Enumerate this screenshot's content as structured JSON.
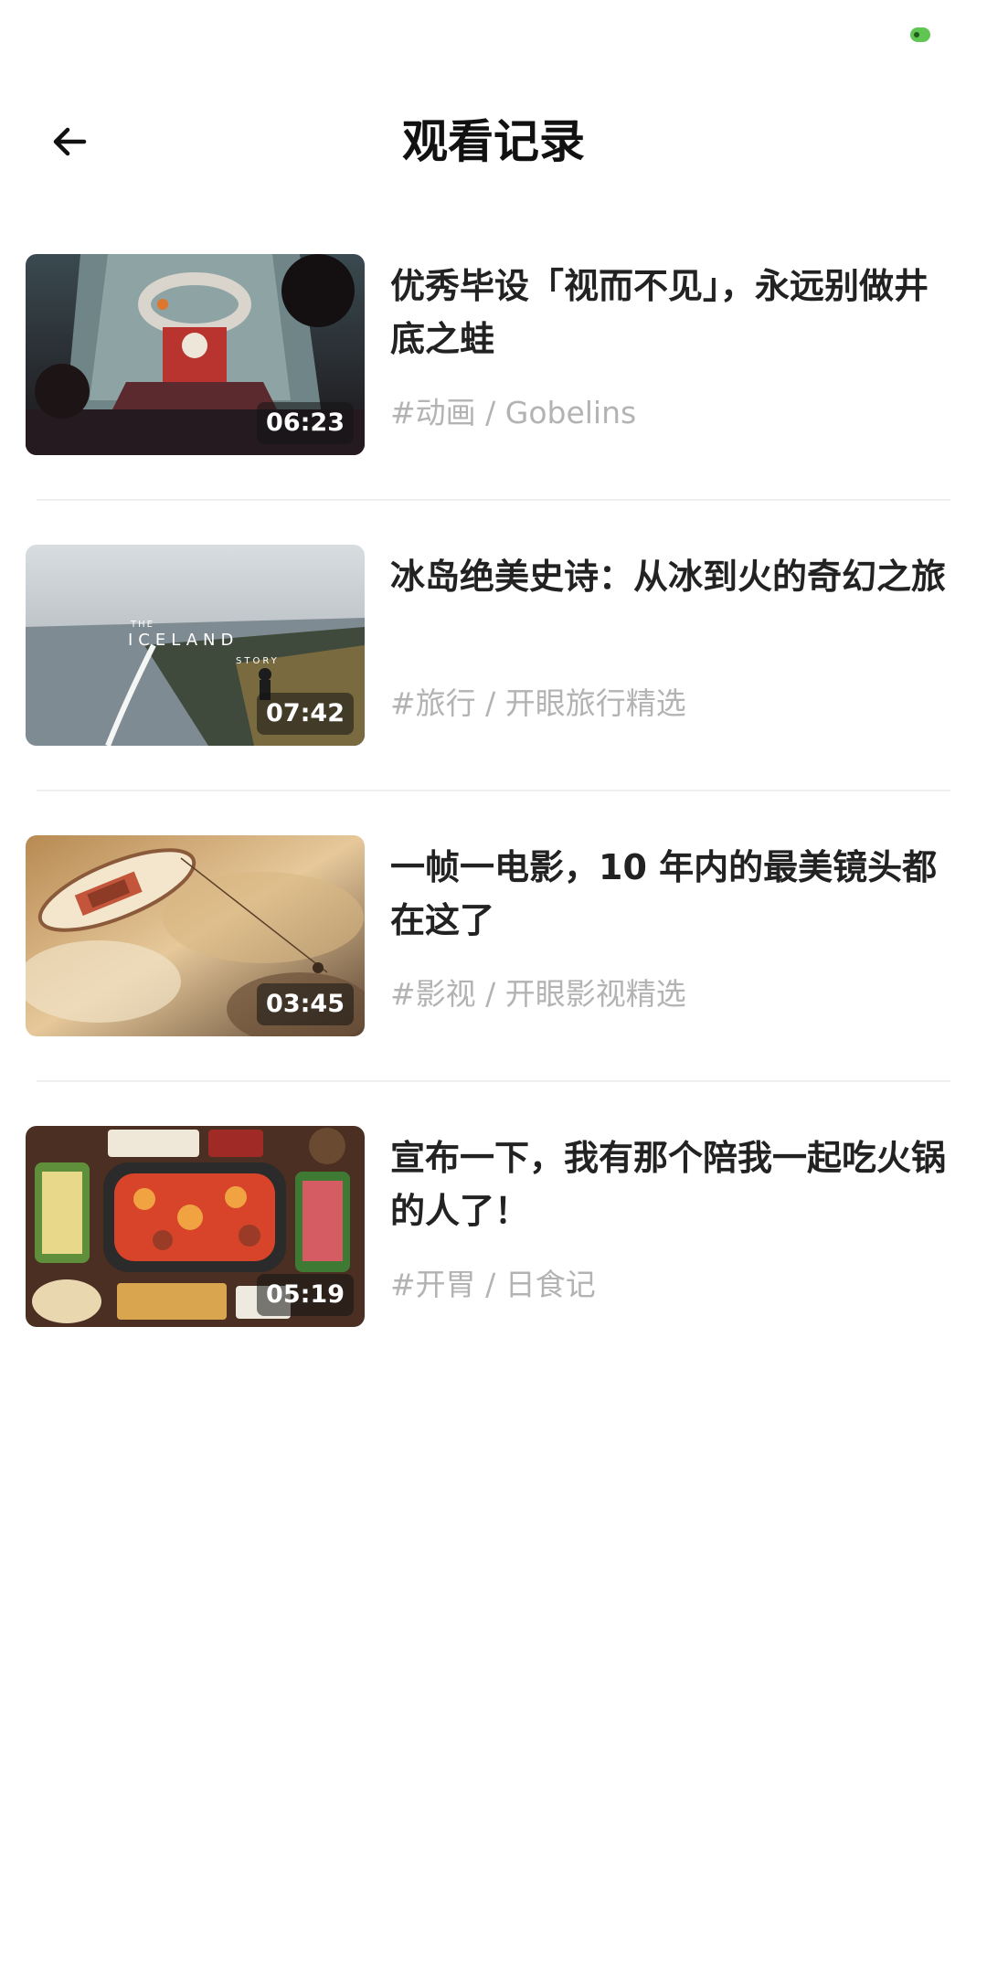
{
  "status_bar": {
    "indicator_color": "#61c554"
  },
  "header": {
    "title": "观看记录",
    "back_icon": "arrow-left-icon"
  },
  "videos": [
    {
      "title": "优秀毕设「视而不见」，永远别做井底之蛙",
      "tags": "#动画 / Gobelins",
      "duration": "06:23",
      "thumbnail": "animation-fantasy-scene"
    },
    {
      "title": "冰岛绝美史诗：从冰到火的奇幻之旅",
      "tags": "#旅行 / 开眼旅行精选",
      "duration": "07:42",
      "thumbnail": "iceland-coast-landscape",
      "thumbnail_overlay_text": [
        "THE",
        "ICELAND",
        "STORY"
      ]
    },
    {
      "title": "一帧一电影，10 年内的最美镜头都在这了",
      "tags": "#影视 / 开眼影视精选",
      "duration": "03:45",
      "thumbnail": "boat-in-golden-clouds"
    },
    {
      "title": "宣布一下，我有那个陪我一起吃火锅的人了！",
      "tags": "#开胃 / 日食记",
      "duration": "05:19",
      "thumbnail": "hotpot-table-spread"
    }
  ]
}
